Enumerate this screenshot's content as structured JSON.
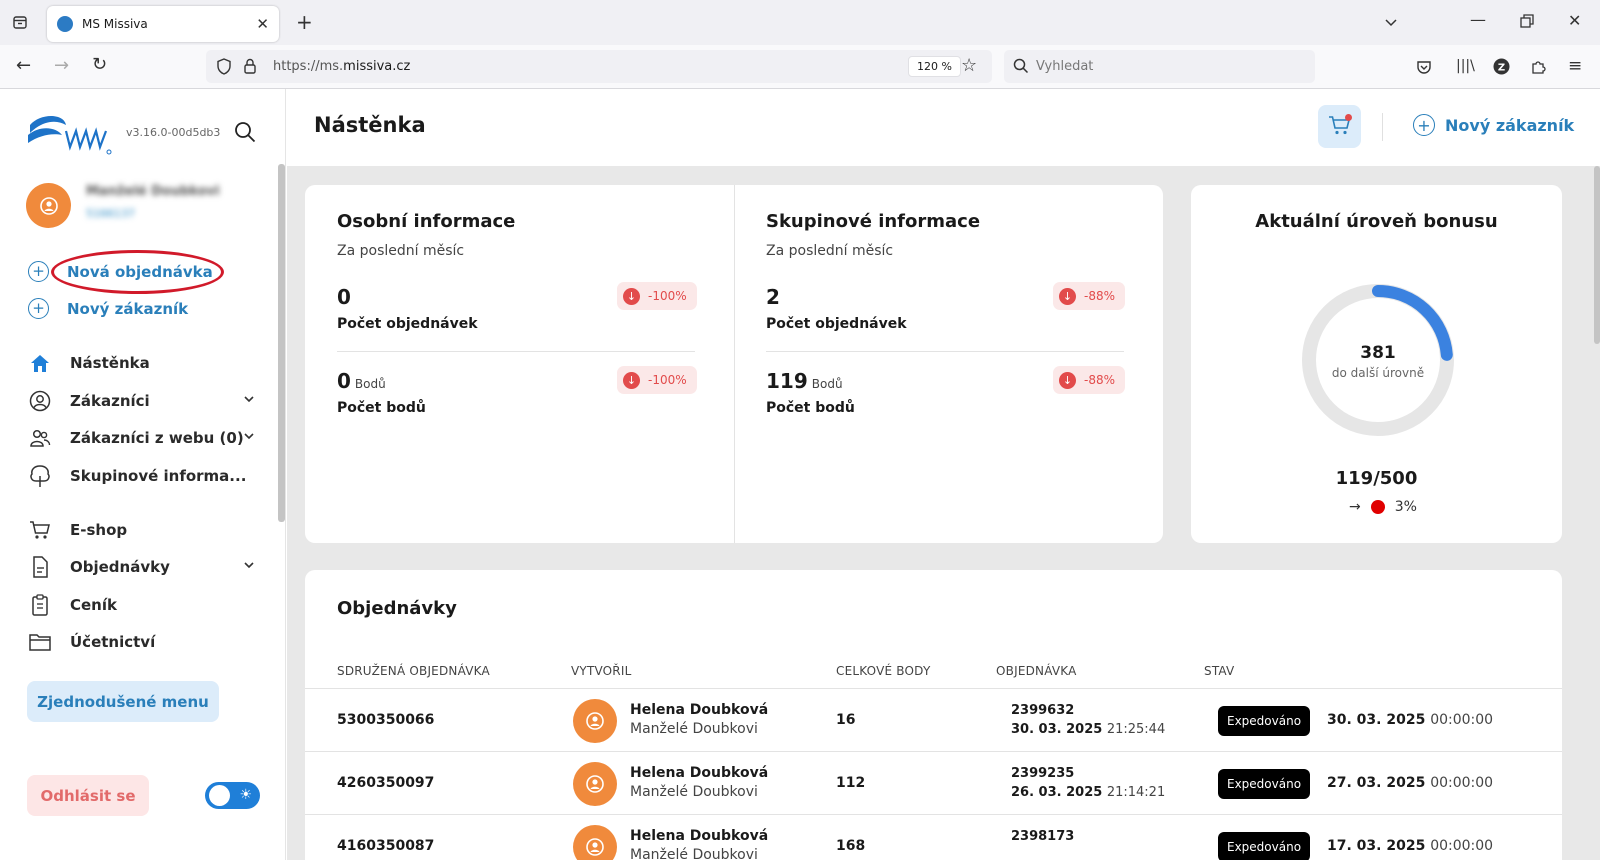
{
  "browser": {
    "tab_title": "MS Missiva",
    "url_prefix": "https://ms.",
    "url_domain": "missiva.cz",
    "zoom": "120 %",
    "search_placeholder": "Vyhledat"
  },
  "sidebar": {
    "version": "v3.16.0-00d5db3",
    "user_name": "Manželé Doubkovi",
    "user_id": "5166137",
    "actions": [
      {
        "label": "Nová objednávka"
      },
      {
        "label": "Nový zákazník"
      }
    ],
    "nav": [
      {
        "label": "Nástěnka",
        "icon": "home-icon"
      },
      {
        "label": "Zákazníci",
        "icon": "user-circle-icon"
      },
      {
        "label": "Zákazníci z webu (0)",
        "icon": "users-icon"
      },
      {
        "label": "Skupinové informa...",
        "icon": "tree-icon"
      },
      {
        "label": "E-shop",
        "icon": "cart-icon"
      },
      {
        "label": "Objednávky",
        "icon": "document-icon"
      },
      {
        "label": "Ceník",
        "icon": "clipboard-icon"
      },
      {
        "label": "Účetnictví",
        "icon": "folder-icon"
      }
    ],
    "simple_menu": "Zjednodušené menu",
    "logout": "Odhlásit se"
  },
  "header": {
    "title": "Nástěnka",
    "new_customer": "Nový zákazník"
  },
  "personal": {
    "title": "Osobní informace",
    "subtitle": "Za poslední měsíc",
    "orders_value": "0",
    "orders_label": "Počet objednávek",
    "orders_delta": "-100%",
    "points_value": "0",
    "points_unit": "Bodů",
    "points_label": "Počet bodů",
    "points_delta": "-100%"
  },
  "group": {
    "title": "Skupinové informace",
    "subtitle": "Za poslední měsíc",
    "orders_value": "2",
    "orders_label": "Počet objednávek",
    "orders_delta": "-88%",
    "points_value": "119",
    "points_unit": "Bodů",
    "points_label": "Počet bodů",
    "points_delta": "-88%"
  },
  "bonus": {
    "title": "Aktuální úroveň bonusu",
    "remaining": "381",
    "remaining_label": "do další úrovně",
    "ratio": "119/500",
    "current": 119,
    "target": 500,
    "percent": "3%"
  },
  "orders": {
    "title": "Objednávky",
    "headers": [
      "SDRUŽENÁ OBJEDNÁVKA",
      "VYTVOŘIL",
      "CELKOVÉ BODY",
      "OBJEDNÁVKA",
      "STAV"
    ],
    "rows": [
      {
        "group_order": "5300350066",
        "creator": "Helena Doubková",
        "creator_group": "Manželé Doubkovi",
        "points": "16",
        "order_no": "2399632",
        "order_date": "30. 03. 2025",
        "order_time": "21:25:44",
        "status": "Expedováno",
        "status_date": "30. 03. 2025",
        "status_time": "00:00:00"
      },
      {
        "group_order": "4260350097",
        "creator": "Helena Doubková",
        "creator_group": "Manželé Doubkovi",
        "points": "112",
        "order_no": "2399235",
        "order_date": "26. 03. 2025",
        "order_time": "21:14:21",
        "status": "Expedováno",
        "status_date": "27. 03. 2025",
        "status_time": "00:00:00"
      },
      {
        "group_order": "4160350087",
        "creator": "Helena Doubková",
        "creator_group": "Manželé Doubkovi",
        "points": "168",
        "order_no": "2398173",
        "order_date": "",
        "order_time": "",
        "status": "Expedováno",
        "status_date": "17. 03. 2025",
        "status_time": "00:00:00"
      }
    ]
  },
  "colors": {
    "accent": "#2a7fba",
    "orange": "#f08a3c",
    "negative": "#e24b4b",
    "gauge": "#3b82e0"
  }
}
